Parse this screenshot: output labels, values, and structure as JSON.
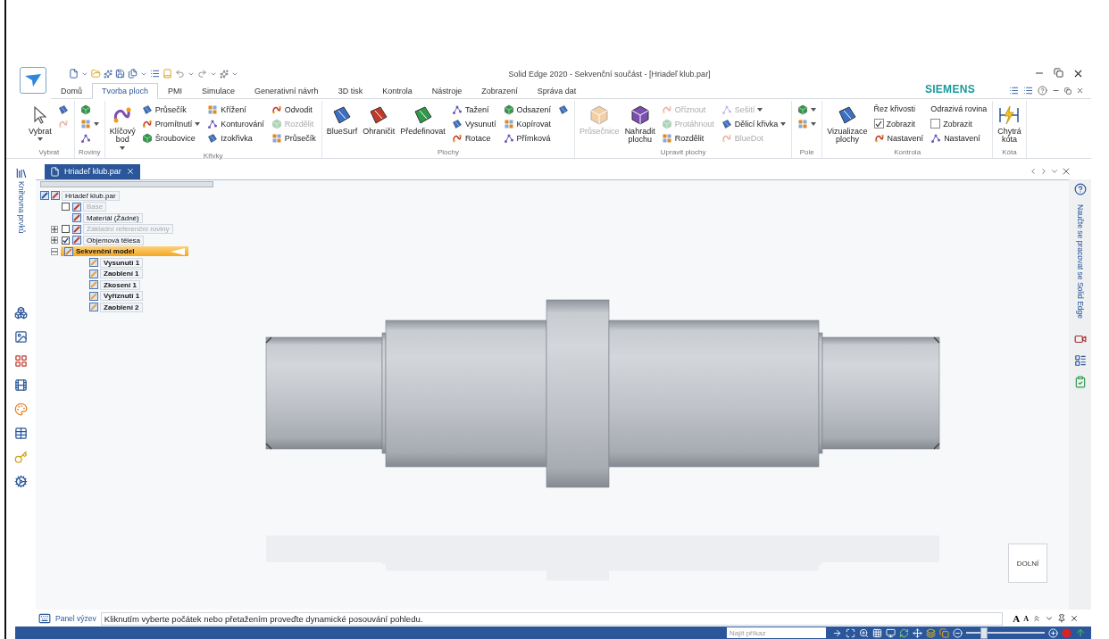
{
  "window": {
    "title": "Solid Edge 2020 - Sekvenční součást - [Hriadeľ klub.par]"
  },
  "tabs": [
    {
      "label": "Domů",
      "selected": false
    },
    {
      "label": "Tvorba ploch",
      "selected": true
    },
    {
      "label": "PMI",
      "selected": false
    },
    {
      "label": "Simulace",
      "selected": false
    },
    {
      "label": "Generativní návrh",
      "selected": false
    },
    {
      "label": "3D tisk",
      "selected": false
    },
    {
      "label": "Kontrola",
      "selected": false
    },
    {
      "label": "Nástroje",
      "selected": false
    },
    {
      "label": "Zobrazení",
      "selected": false
    },
    {
      "label": "Správa dat",
      "selected": false
    }
  ],
  "brand": "SIEMENS",
  "ribbon": [
    {
      "label": "Vybrat",
      "columns": [
        [
          {
            "label": "Vybrat",
            "kind": "large",
            "disabled": false,
            "dropdown": true
          }
        ],
        [
          {
            "kind": "icon",
            "disabled": false,
            "dropdown": false
          },
          {
            "kind": "icon",
            "disabled": true,
            "dropdown": false
          }
        ]
      ]
    },
    {
      "label": "Roviny",
      "columns": [
        [
          {
            "kind": "icon",
            "disabled": false,
            "dropdown": false
          },
          {
            "kind": "icon",
            "disabled": false,
            "dropdown": true
          },
          {
            "kind": "icon",
            "disabled": false,
            "dropdown": false
          }
        ]
      ]
    },
    {
      "label": "Křivky",
      "columns": [
        [
          {
            "label": "Klíčový bod",
            "kind": "large",
            "disabled": false,
            "dropdown": true
          }
        ],
        [
          {
            "label": "Průsečík",
            "kind": "small",
            "disabled": false,
            "dropdown": false
          },
          {
            "label": "Promítnutí",
            "kind": "small",
            "disabled": false,
            "dropdown": true
          },
          {
            "label": "Šroubovice",
            "kind": "small",
            "disabled": false,
            "dropdown": false
          }
        ],
        [
          {
            "label": "Křížení",
            "kind": "small",
            "disabled": false,
            "dropdown": false
          },
          {
            "label": "Konturování",
            "kind": "small",
            "disabled": false,
            "dropdown": false
          },
          {
            "label": "Izokřivka",
            "kind": "small",
            "disabled": false,
            "dropdown": false
          }
        ],
        [
          {
            "label": "Odvodit",
            "kind": "small",
            "disabled": false,
            "dropdown": false
          },
          {
            "label": "Rozdělit",
            "kind": "small",
            "disabled": true,
            "dropdown": false
          },
          {
            "label": "Průsečík",
            "kind": "small",
            "disabled": false,
            "dropdown": false
          }
        ]
      ]
    },
    {
      "label": "Plochy",
      "columns": [
        [
          {
            "label": "BlueSurf",
            "kind": "large",
            "disabled": false,
            "dropdown": false
          }
        ],
        [
          {
            "label": "Ohraničit",
            "kind": "large",
            "disabled": false,
            "dropdown": false
          }
        ],
        [
          {
            "label": "Předefinovat",
            "kind": "large",
            "disabled": false,
            "dropdown": false
          }
        ],
        [
          {
            "label": "Tažení",
            "kind": "small",
            "disabled": false,
            "dropdown": false
          },
          {
            "label": "Vysunutí",
            "kind": "small",
            "disabled": false,
            "dropdown": false
          },
          {
            "label": "Rotace",
            "kind": "small",
            "disabled": false,
            "dropdown": false
          }
        ],
        [
          {
            "label": "Odsazení",
            "kind": "small",
            "disabled": false,
            "dropdown": false
          },
          {
            "label": "Kopírovat",
            "kind": "small",
            "disabled": false,
            "dropdown": false
          },
          {
            "label": "Přímková",
            "kind": "small",
            "disabled": false,
            "dropdown": false
          }
        ],
        [
          {
            "kind": "icon",
            "disabled": false,
            "dropdown": false
          }
        ]
      ]
    },
    {
      "label": "Upravit plochy",
      "columns": [
        [
          {
            "label": "Průsečnice",
            "kind": "large",
            "disabled": true,
            "dropdown": false
          }
        ],
        [
          {
            "label": "Nahradit plochu",
            "kind": "large",
            "disabled": false,
            "dropdown": false
          }
        ],
        [
          {
            "label": "Oříznout",
            "kind": "small",
            "disabled": true,
            "dropdown": false
          },
          {
            "label": "Protáhnout",
            "kind": "small",
            "disabled": true,
            "dropdown": false
          },
          {
            "label": "Rozdělit",
            "kind": "small",
            "disabled": false,
            "dropdown": false
          }
        ],
        [
          {
            "label": "Sešití",
            "kind": "small",
            "disabled": true,
            "dropdown": true
          },
          {
            "label": "Dělicí křivka",
            "kind": "small",
            "disabled": false,
            "dropdown": true
          },
          {
            "label": "BlueDot",
            "kind": "small",
            "disabled": true,
            "dropdown": false
          }
        ]
      ]
    },
    {
      "label": "Pole",
      "columns": [
        [
          {
            "kind": "icon",
            "disabled": false,
            "dropdown": true
          },
          {
            "kind": "icon",
            "disabled": false,
            "dropdown": true
          }
        ]
      ]
    },
    {
      "label": "Kontrola",
      "columns": [
        [
          {
            "label": "Vizualizace plochy",
            "kind": "large",
            "disabled": false,
            "dropdown": false
          }
        ],
        [
          {
            "label": "Řez křivosti",
            "kind": "heading",
            "disabled": false,
            "dropdown": false
          },
          {
            "label": "Zobrazit",
            "kind": "checkbox",
            "checked": true,
            "disabled": false,
            "dropdown": false
          },
          {
            "label": "Nastavení",
            "kind": "small",
            "disabled": false,
            "dropdown": false
          }
        ],
        [
          {
            "label": "Odrazivá rovina",
            "kind": "heading",
            "disabled": false,
            "dropdown": false
          },
          {
            "label": "Zobrazit",
            "kind": "checkbox",
            "checked": false,
            "disabled": false,
            "dropdown": false
          },
          {
            "label": "Nastavení",
            "kind": "small",
            "disabled": false,
            "dropdown": false
          }
        ]
      ]
    },
    {
      "label": "Kóta",
      "columns": [
        [
          {
            "label": "Chytrá kóta",
            "kind": "large",
            "disabled": false,
            "dropdown": false
          }
        ]
      ]
    }
  ],
  "document_tab": {
    "label": "Hriadeľ klub.par"
  },
  "left_panel": {
    "label": "Knihovna prvků"
  },
  "tree": {
    "label": "Hriadeľ klub.par",
    "disabled": false,
    "selected": false,
    "children": [
      {
        "label": "Base",
        "checked": false,
        "disabled": true,
        "selected": false
      },
      {
        "label": "Materiál (Žádné)",
        "disabled": false,
        "selected": false
      },
      {
        "label": "Základní referenční roviny",
        "expanded": false,
        "checked": false,
        "disabled": true,
        "selected": false
      },
      {
        "label": "Objemová tělesa",
        "expanded": false,
        "checked": true,
        "disabled": false,
        "selected": false
      },
      {
        "label": "Sekvenční model",
        "expanded": true,
        "disabled": false,
        "selected": true,
        "children": [
          {
            "label": "Vysunutí 1",
            "disabled": false,
            "selected": false
          },
          {
            "label": "Zaoblení 1",
            "disabled": false,
            "selected": false
          },
          {
            "label": "Zkosení 1",
            "disabled": false,
            "selected": false
          },
          {
            "label": "Vyříznutí 1",
            "disabled": false,
            "selected": false
          },
          {
            "label": "Zaoblení 2",
            "disabled": false,
            "selected": false
          }
        ]
      }
    ]
  },
  "right_panel": {
    "label": "Naučte se pracovat se Solid Edge"
  },
  "view_cube": {
    "label": "DOLNÍ"
  },
  "prompt_bar": {
    "label": "Panel výzev",
    "message": "Kliknutím vyberte počátek nebo přetažením proveďte dynamické posouvání pohledu.",
    "font_controls": [
      "A",
      "A"
    ]
  },
  "status_bar": {
    "search": {
      "placeholder": "Najít příkaz"
    },
    "zoom": {
      "level": 0.22
    }
  }
}
